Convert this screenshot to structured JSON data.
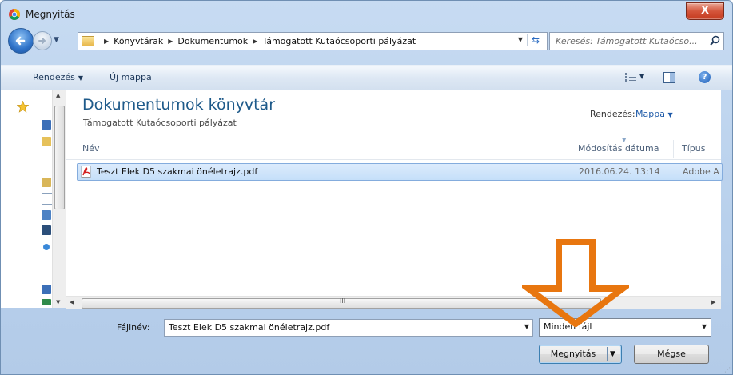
{
  "window": {
    "title": "Megnyitás",
    "close_label": "X"
  },
  "address": {
    "crumbs": [
      "Könyvtárak",
      "Dokumentumok",
      "Támogatott Kutaócsoporti pályázat"
    ]
  },
  "search": {
    "placeholder": "Keresés: Támogatott Kutaócso..."
  },
  "toolbar": {
    "organize_label": "Rendezés",
    "new_folder_label": "Új mappa"
  },
  "library": {
    "title": "Dokumentumok könyvtár",
    "subtitle": "Támogatott Kutaócsoporti pályázat",
    "arrange_label": "Rendezés:",
    "arrange_value": "Mappa"
  },
  "columns": {
    "name": "Név",
    "modified": "Módosítás dátuma",
    "type": "Típus"
  },
  "files": [
    {
      "name": "Teszt Elek D5 szakmai önéletrajz.pdf",
      "modified": "2016.06.24. 13:14",
      "type": "Adobe A"
    }
  ],
  "bottom": {
    "filename_label": "Fájlnév:",
    "filename_value": "Teszt Elek D5 szakmai önéletrajz.pdf",
    "filter_value": "Minden fájl",
    "open_label": "Megnyitás",
    "cancel_label": "Mégse"
  },
  "colors": {
    "accent_arrow": "#e8760f",
    "selection": "#cce4fb"
  },
  "icons": [
    "chrome-icon",
    "back-icon",
    "forward-icon",
    "library-folder-icon",
    "refresh-icon",
    "search-icon",
    "view-icon",
    "preview-pane-icon",
    "help-icon",
    "pdf-icon"
  ]
}
